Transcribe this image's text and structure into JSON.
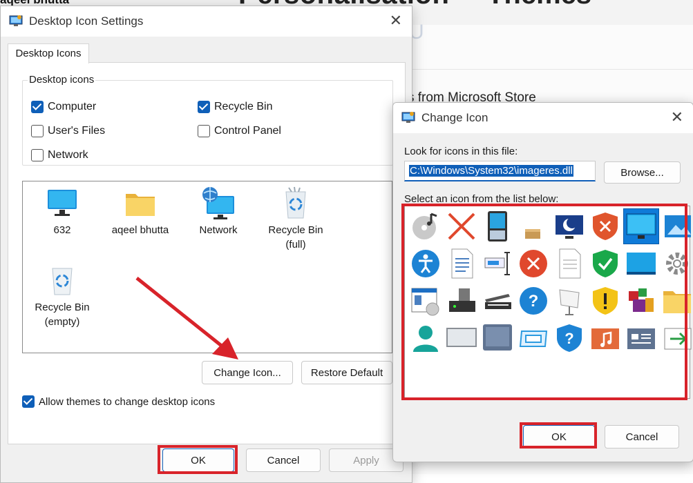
{
  "background": {
    "top_left_name": "aqeel bhutta",
    "big_title_left": "Personalisation",
    "big_title_right": "Themes",
    "store_text": "s from Microsoft Store",
    "ghost_glyph": "U"
  },
  "desktop_icon_settings": {
    "title": "Desktop Icon Settings",
    "close_glyph": "✕",
    "tab_label": "Desktop Icons",
    "group_label": "Desktop icons",
    "checkboxes": [
      {
        "label": "Computer",
        "checked": true
      },
      {
        "label": "Recycle Bin",
        "checked": true
      },
      {
        "label": "User's Files",
        "checked": false
      },
      {
        "label": "Control Panel",
        "checked": false
      },
      {
        "label": "Network",
        "checked": false
      }
    ],
    "icons": [
      {
        "label": "632",
        "icon": "monitor-icon"
      },
      {
        "label": "aqeel bhutta",
        "icon": "folder-icon"
      },
      {
        "label": "Network",
        "icon": "network-globe-icon"
      },
      {
        "label": "Recycle Bin (full)",
        "label_line1": "Recycle Bin",
        "label_line2": "(full)",
        "icon": "recycle-bin-full-icon"
      },
      {
        "label": "Recycle Bin (empty)",
        "label_line1": "Recycle Bin",
        "label_line2": "(empty)",
        "icon": "recycle-bin-empty-icon"
      }
    ],
    "change_icon_button": "Change Icon...",
    "restore_default_button": "Restore Default",
    "allow_themes_label": "Allow themes to change desktop icons",
    "allow_themes_checked": true,
    "ok_button": "OK",
    "cancel_button": "Cancel",
    "apply_button": "Apply"
  },
  "change_icon": {
    "title": "Change Icon",
    "close_glyph": "✕",
    "look_label": "Look for icons in this file:",
    "file_path": "C:\\Windows\\System32\\imageres.dll",
    "browse_button": "Browse...",
    "select_label": "Select an icon from the list below:",
    "icons": [
      "disc-music-icon",
      "red-x-icon",
      "handheld-device-icon",
      "small-box-icon",
      "monitor-moon-icon",
      "shield-error-icon",
      "monitor-selected-icon",
      "picture-folder-icon",
      "accessibility-icon",
      "document-lines-icon",
      "text-cursor-box-icon",
      "error-circle-icon",
      "blank-document-icon",
      "shield-check-icon",
      "blue-monitor-icon",
      "gear-icon",
      "window-disc-icon",
      "drive-device-icon",
      "scanner-icon",
      "help-circle-icon",
      "projector-screen-icon",
      "shield-warning-icon",
      "programs-blocks-icon",
      "folder-icon",
      "person-icon",
      "empty-frame-icon",
      "tablet-icon",
      "blue-rect-icon",
      "shield-help-icon",
      "music-folder-icon",
      "news-folder-icon",
      "arrow-window-icon"
    ],
    "selected_index": 6,
    "ok_button": "OK",
    "cancel_button": "Cancel"
  },
  "colors": {
    "accent": "#0f5fb8",
    "annotation_red": "#d8232a"
  }
}
